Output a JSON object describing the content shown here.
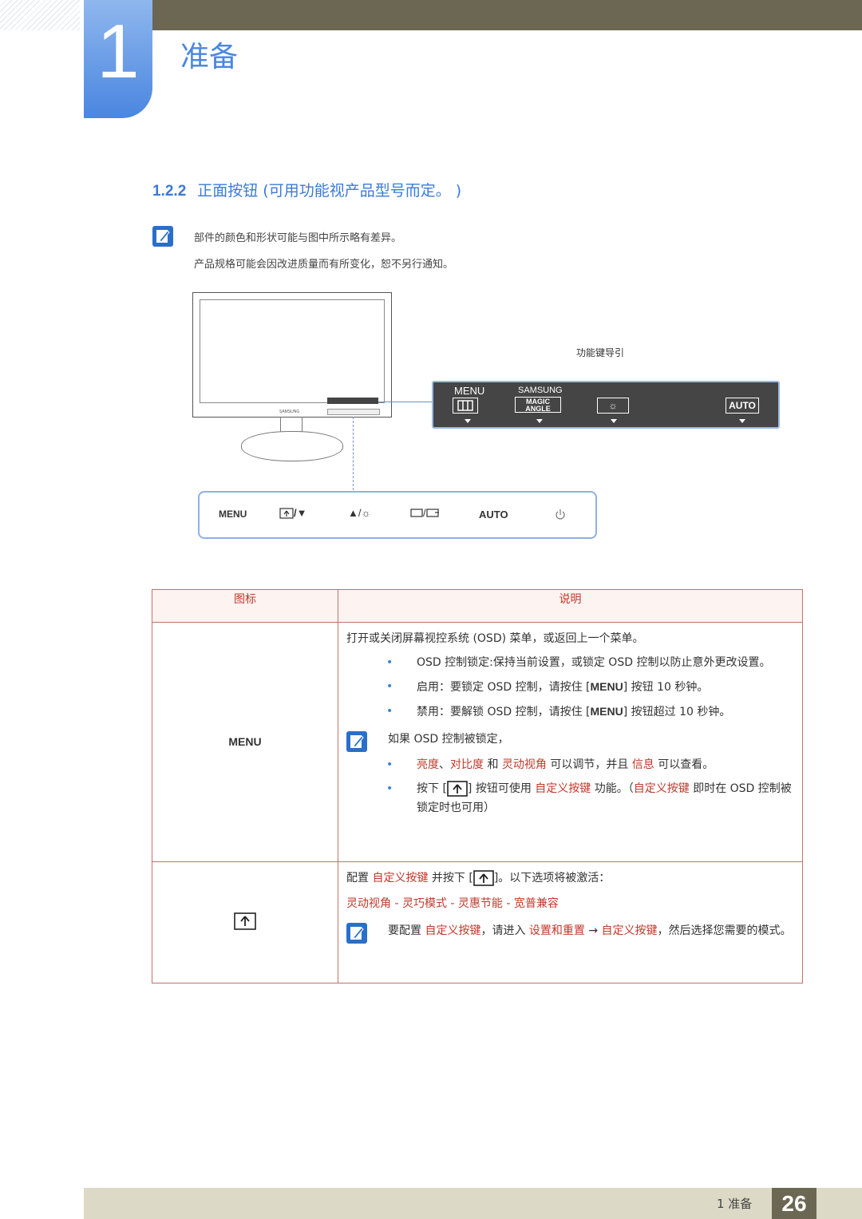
{
  "header": {
    "chapter_number": "1",
    "chapter_title": "准备"
  },
  "section": {
    "number": "1.2.2",
    "title": "正面按钮 (可用功能视产品型号而定。 )"
  },
  "notes": [
    "部件的颜色和形状可能与图中所示略有差异。",
    "产品规格可能会因改进质量而有所变化，恕不另行通知。"
  ],
  "figure": {
    "monitor_brand": "SAMSUNG",
    "guide_label": "功能键导引",
    "key_panel": {
      "menu_label": "MENU",
      "brand_label": "SAMSUNG",
      "magic": "MAGIC",
      "angle": "ANGLE",
      "auto_label": "AUTO"
    },
    "front_panel": {
      "menu": "MENU",
      "btn2": "/▼",
      "btn3": "▲/☼",
      "btn4": "/",
      "auto": "AUTO"
    }
  },
  "table": {
    "headers": {
      "icon": "图标",
      "desc": "说明"
    },
    "rows": {
      "menu": {
        "icon_label": "MENU",
        "intro": "打开或关闭屏幕视控系统 (OSD) 菜单，或返回上一个菜单。",
        "b1": "OSD 控制锁定:保持当前设置，或锁定 OSD 控制以防止意外更改设置。",
        "b2_pre": "启用：要锁定 OSD 控制，请按住 [",
        "b2_key": "MENU",
        "b2_post": "] 按钮 10 秒钟。",
        "b3_pre": "禁用：要解锁 OSD 控制，请按住 [",
        "b3_key": "MENU",
        "b3_post": "] 按钮超过 10 秒钟。",
        "note": "如果 OSD 控制被锁定，",
        "b4_r1": "亮度",
        "b4_sep": "、",
        "b4_r2": "对比度",
        "b4_and": " 和 ",
        "b4_r3": "灵动视角",
        "b4_mid": " 可以调节，并且 ",
        "b4_r4": "信息",
        "b4_end": " 可以查看。",
        "b5_pre": "按下 [",
        "b5_mid": "] 按钮可使用 ",
        "b5_r1": "自定义按键",
        "b5_mid2": " 功能。（",
        "b5_r2": "自定义按键",
        "b5_end": " 即时在 OSD 控制被锁定时也可用）"
      },
      "custom": {
        "intro_pre": "配置 ",
        "intro_r": "自定义按键",
        "intro_mid": " 并按下 [",
        "intro_end": "]。以下选项将被激活：",
        "options": "灵动视角 - 灵巧模式 - 灵惠节能 - 宽普兼容",
        "note_pre": "要配置 ",
        "note_r1": "自定义按键",
        "note_mid": "，请进入 ",
        "note_r2": "设置和重置",
        "note_arrow": " → ",
        "note_r3": "自定义按键",
        "note_end": "，然后选择您需要的模式。"
      }
    }
  },
  "footer": {
    "chapter": "1 准备",
    "page": "26"
  }
}
